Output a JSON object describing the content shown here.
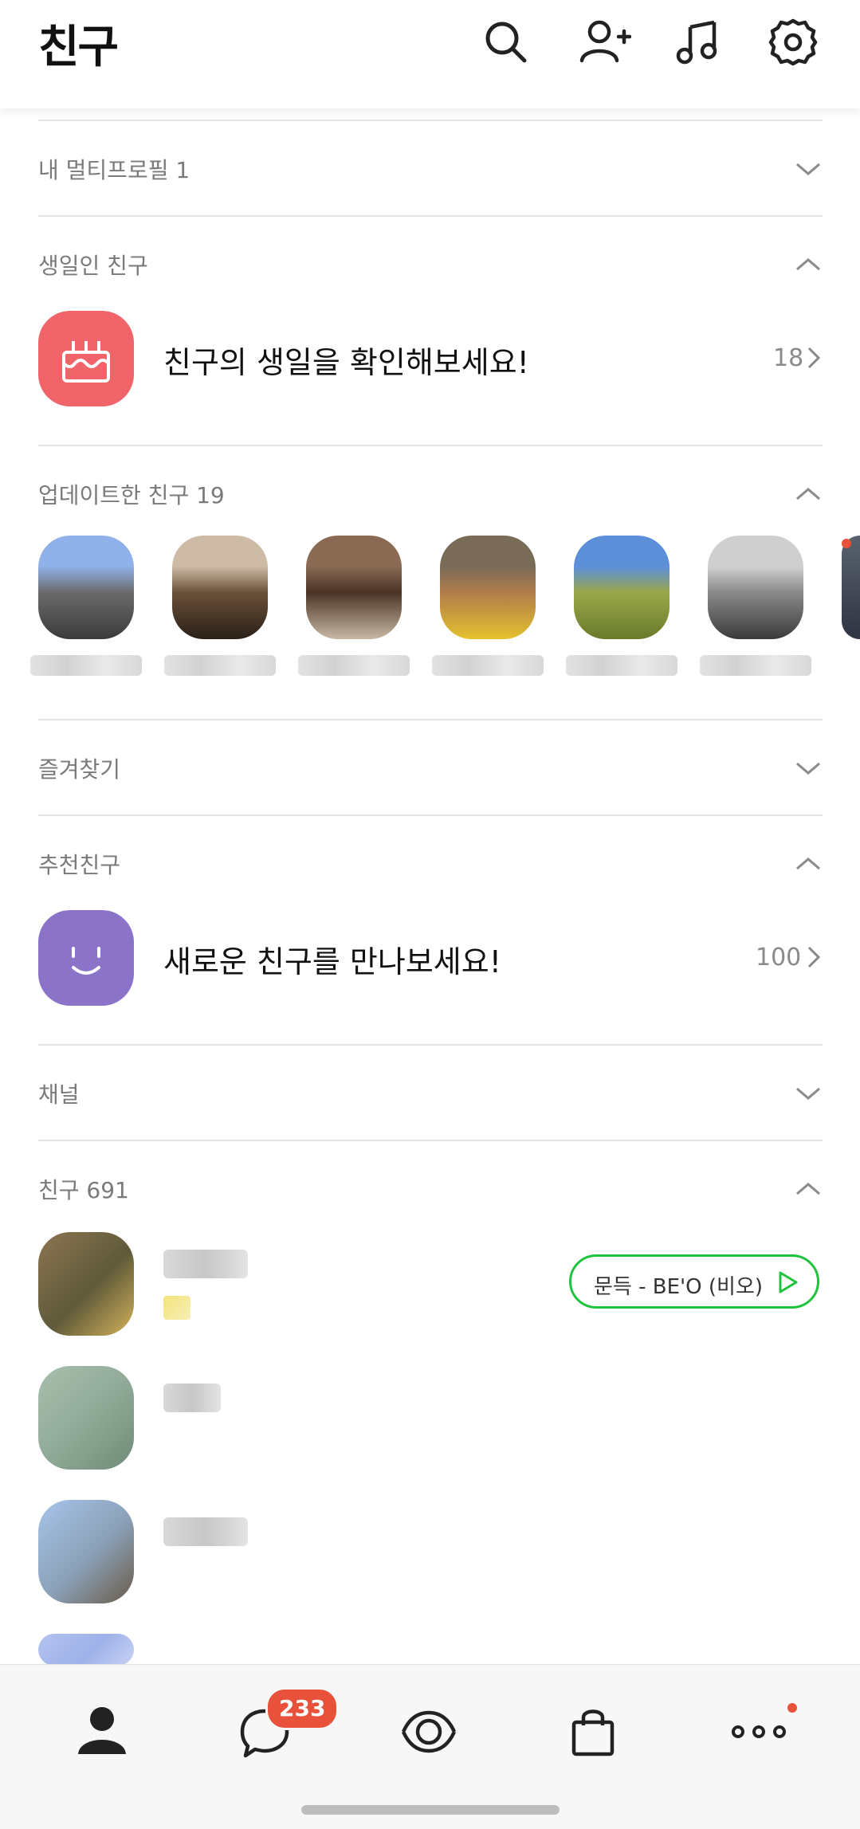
{
  "header": {
    "title": "친구",
    "icons": [
      "search-icon",
      "add-friend-icon",
      "music-icon",
      "settings-icon"
    ]
  },
  "sections": {
    "multiprofile": {
      "label": "내 멀티프로필 1",
      "state": "collapsed"
    },
    "birthday": {
      "label": "생일인 친구",
      "state": "expanded",
      "text": "친구의 생일을 확인해보세요!",
      "count": "18",
      "icon_color": "#f0646a"
    },
    "updated": {
      "label": "업데이트한 친구 19",
      "state": "expanded",
      "thumbs": [
        {
          "top": "#8fb0e8",
          "mid": "#6a6a6a",
          "bot": "#3b3b3b"
        },
        {
          "top": "#cdbba5",
          "mid": "#6b5038",
          "bot": "#2a2018"
        },
        {
          "top": "#8a6a52",
          "mid": "#4a3326",
          "bot": "#c9b8a4"
        },
        {
          "top": "#7a6a58",
          "mid": "#b07d4a",
          "bot": "#e6c12e"
        },
        {
          "top": "#5b8fd8",
          "mid": "#9aa84a",
          "bot": "#6a7a2a"
        },
        {
          "top": "#cfcfcf",
          "mid": "#8a8a8a",
          "bot": "#3a3a3a"
        }
      ]
    },
    "favorites": {
      "label": "즐겨찾기",
      "state": "collapsed"
    },
    "recommended": {
      "label": "추천친구",
      "state": "expanded",
      "text": "새로운 친구를 만나보세요!",
      "count": "100",
      "icon_color": "#8b73c8"
    },
    "channel": {
      "label": "채널",
      "state": "collapsed"
    },
    "friends": {
      "label": "친구 691",
      "state": "expanded",
      "music": "문득 - BE'O (비오)",
      "rows": [
        {
          "a": "#8c7450",
          "b": "#5f5a3a",
          "c": "#d4b25a"
        },
        {
          "a": "#a9bfae",
          "b": "#8fa896",
          "c": "#6f8a76"
        },
        {
          "a": "#a6c4ea",
          "b": "#8aa0b6",
          "c": "#6a5a48"
        },
        {
          "a": "#b3c3f0",
          "b": "#9fb1ea",
          "c": "#c8d2f4"
        }
      ]
    }
  },
  "tabbar": {
    "tabs": [
      "friends-tab",
      "chats-tab",
      "view-tab",
      "shopping-tab",
      "more-tab"
    ],
    "chat_badge": "233"
  }
}
